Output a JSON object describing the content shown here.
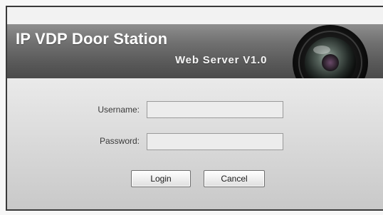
{
  "header": {
    "title": "IP VDP Door Station",
    "subtitle": "Web Server V1.0"
  },
  "login": {
    "username_label": "Username:",
    "username_value": "",
    "password_label": "Password:",
    "password_value": "",
    "login_button": "Login",
    "cancel_button": "Cancel"
  },
  "icons": {
    "banner_decoration": "camera-lens-icon"
  },
  "colors": {
    "banner_dark": "#4a4a4a",
    "banner_light": "#8e8e8e",
    "frame_border": "#3a3a3a"
  }
}
